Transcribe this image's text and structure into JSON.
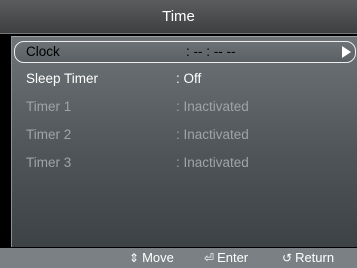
{
  "title": "Time",
  "menu": [
    {
      "label": "Clock",
      "value": ": -- : -- --",
      "state": "selected"
    },
    {
      "label": "Sleep Timer",
      "value": ": Off",
      "state": "enabled"
    },
    {
      "label": "Timer 1",
      "value": ": Inactivated",
      "state": "disabled"
    },
    {
      "label": "Timer 2",
      "value": ": Inactivated",
      "state": "disabled"
    },
    {
      "label": "Timer 3",
      "value": ": Inactivated",
      "state": "disabled"
    }
  ],
  "footer": {
    "move": {
      "icon": "updown-arrows-icon",
      "glyph": "⇕",
      "label": "Move"
    },
    "enter": {
      "icon": "enter-icon",
      "glyph": "⏎",
      "label": "Enter"
    },
    "return": {
      "icon": "return-icon",
      "glyph": "↺",
      "label": "Return"
    }
  },
  "colors": {
    "panel_top": "#6e7477",
    "panel_bottom": "#3d4245",
    "disabled_text": "#9ea4a7",
    "footer": "#7a8083"
  }
}
